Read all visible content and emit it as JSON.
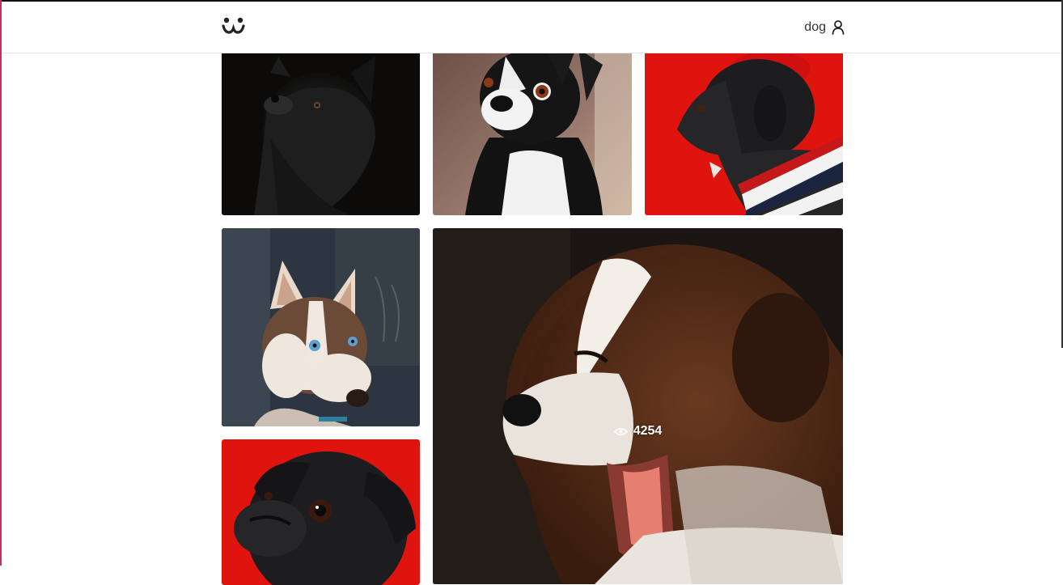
{
  "header": {
    "logo_icon": "paw-smiley-logo-icon",
    "username": "dog",
    "user_icon": "user-icon"
  },
  "gallery": {
    "tiles": [
      {
        "subject": "black-fluffy-dog-photo"
      },
      {
        "subject": "boston-terrier-photo"
      },
      {
        "subject": "pug-red-beret-photo"
      },
      {
        "subject": "husky-photo"
      },
      {
        "subject": "yawning-puppy-photo",
        "views": "4254",
        "views_icon": "eye-icon"
      },
      {
        "subject": "pug-red-background-photo"
      }
    ]
  },
  "colors": {
    "red_backdrop": "#e0140f",
    "header_border": "#e6e6e6"
  }
}
